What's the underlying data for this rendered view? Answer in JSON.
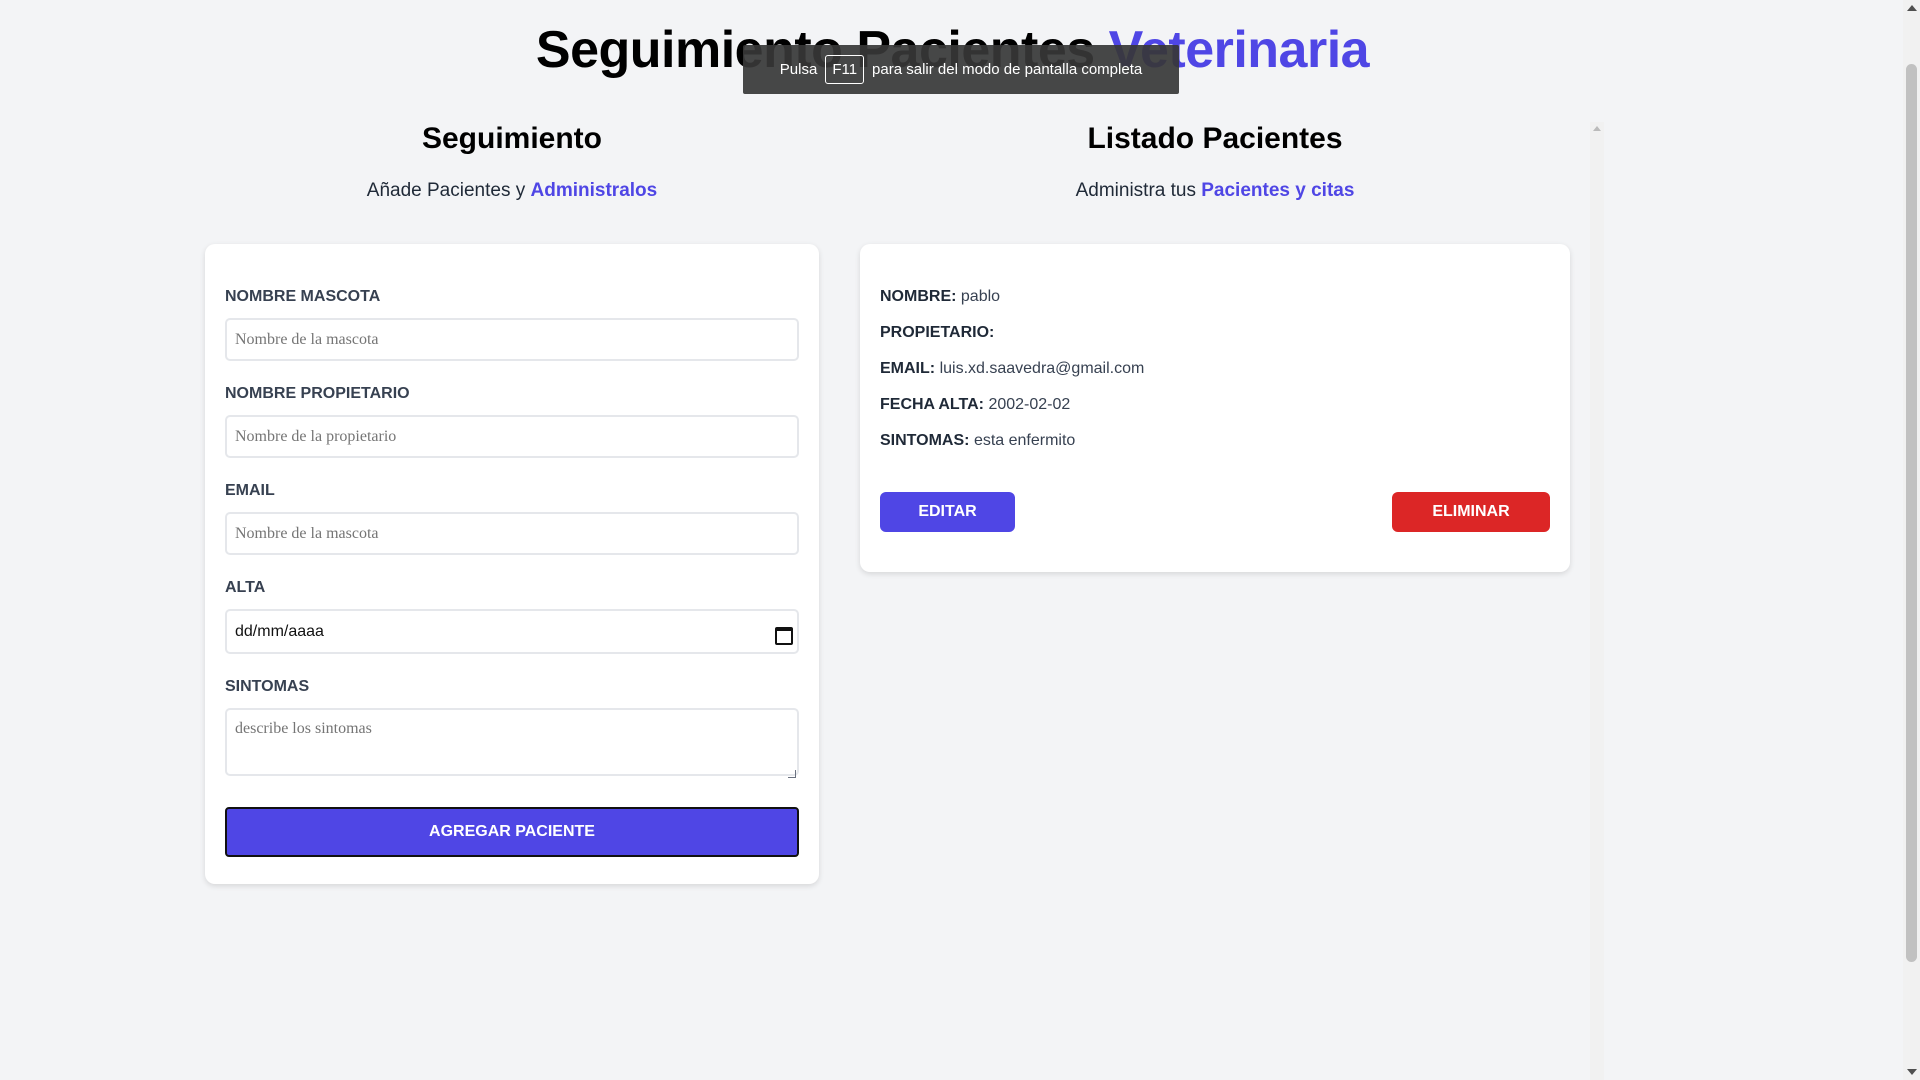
{
  "header": {
    "title_part1": "Seguimiento Pacientes",
    "title_part2": "Veterinaria"
  },
  "form_section": {
    "heading": "Seguimiento",
    "subtitle_plain": "Añade Pacientes y",
    "subtitle_accent": "Administralos",
    "fields": {
      "pet_name": {
        "label": "Nombre Mascota",
        "placeholder": "Nombre de la mascota",
        "value": ""
      },
      "owner_name": {
        "label": "Nombre Propietario",
        "placeholder": "Nombre de la propietario",
        "value": ""
      },
      "email": {
        "label": "Email",
        "placeholder": "Nombre de la mascota",
        "value": ""
      },
      "date": {
        "label": "Alta",
        "display": "dd/mm/aaaa"
      },
      "symptoms": {
        "label": "Sintomas",
        "placeholder": "describe los sintomas",
        "value": ""
      }
    },
    "submit_label": "Agregar Paciente"
  },
  "list_section": {
    "heading": "Listado Pacientes",
    "subtitle_plain": "Administra tus",
    "subtitle_accent": "Pacientes y citas",
    "patients": [
      {
        "name_label": "Nombre:",
        "name_value": "pablo",
        "owner_label": "Propietario:",
        "owner_value": "",
        "email_label": "Email:",
        "email_value": "luis.xd.saavedra@gmail.com",
        "date_label": "Fecha Alta:",
        "date_value": "2002-02-02",
        "symptoms_label": "Sintomas:",
        "symptoms_value": "esta enfermito",
        "edit_label": "Editar",
        "delete_label": "Eliminar"
      }
    ]
  },
  "fullscreen_toast": {
    "text_before": "Pulsa",
    "key": "F11",
    "text_after": "para salir del modo de pantalla completa"
  },
  "colors": {
    "accent": "#4f46e5",
    "danger": "#dc2626",
    "background": "#f3f4f6"
  }
}
